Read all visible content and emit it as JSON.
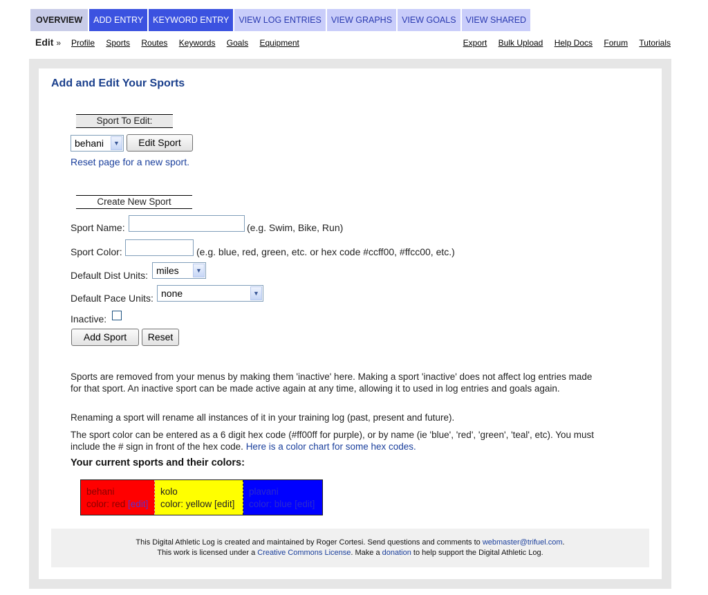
{
  "tabs": [
    {
      "label": "OVERVIEW"
    },
    {
      "label": "ADD ENTRY"
    },
    {
      "label": "KEYWORD ENTRY"
    },
    {
      "label": "VIEW LOG ENTRIES"
    },
    {
      "label": "VIEW GRAPHS"
    },
    {
      "label": "VIEW GOALS"
    },
    {
      "label": "VIEW SHARED"
    }
  ],
  "subnav": {
    "edit_label": "Edit",
    "edit_raquo": "»",
    "left": [
      "Profile",
      "Sports",
      "Routes",
      "Keywords",
      "Goals",
      "Equipment"
    ],
    "right": [
      "Export",
      "Bulk Upload",
      "Help Docs",
      "Forum",
      "Tutorials"
    ]
  },
  "page": {
    "title": "Add and Edit Your Sports",
    "edit_section": {
      "heading": "Sport To Edit:",
      "selected_sport": "behani",
      "edit_button": "Edit Sport",
      "reset_link": "Reset page for a new sport."
    },
    "create_section": {
      "heading": "Create New Sport",
      "name_label": "Sport Name:",
      "name_value": "",
      "name_hint": "(e.g. Swim, Bike, Run)",
      "color_label": "Sport Color:",
      "color_value": "",
      "color_hint": "(e.g. blue, red, green, etc. or hex code #ccff00, #ffcc00, etc.)",
      "dist_label": "Default Dist Units:",
      "dist_value": "miles",
      "pace_label": "Default Pace Units:",
      "pace_value": "none",
      "inactive_label": "Inactive:",
      "inactive_checked": false,
      "add_button": "Add Sport",
      "reset_button": "Reset"
    },
    "info": {
      "p1": "Sports are removed from your menus by making them 'inactive' here. Making a sport 'inactive' does not affect log entries made for that sport. An inactive sport can be made active again at any time, allowing it to used in log entries and goals again.",
      "p2": "Renaming a sport will rename all instances of it in your training log (past, present and future).",
      "p3_text": "The sport color can be entered as a 6 digit hex code (#ff00ff for purple), or by name (ie 'blue', 'red', 'green', 'teal', etc). You must include the # sign in front of the hex code.",
      "p3_link": "Here is a color chart for some hex codes."
    },
    "current_heading": "Your current sports and their colors:",
    "sports": [
      {
        "name": "behani",
        "color_text": "color: red",
        "edit": "[edit]",
        "color": "#ff0000"
      },
      {
        "name": "kolo",
        "color_text": "color: yellow",
        "edit": "[edit]",
        "color": "#ffff00"
      },
      {
        "name": "plavani",
        "color_text": "color: blue",
        "edit": "[edit]",
        "color": "#0000ff"
      }
    ]
  },
  "footer": {
    "line1_prefix": "This Digital Athletic Log is created and maintained by Roger Cortesi. Send questions and comments to",
    "email": "webmaster@trifuel.com",
    "line1_suffix": ".",
    "line2_prefix": "This work is licensed under a",
    "license_link": "Creative Commons License",
    "line2_mid": ". Make a",
    "donation_link": "donation",
    "line2_suffix": "to help support the Digital Athletic Log."
  },
  "colors": {
    "tab_active": "#3b52e0",
    "tab_inactive": "#c9cdfa",
    "title_blue": "#1a3f8c",
    "link_blue": "#1a3f9c"
  }
}
